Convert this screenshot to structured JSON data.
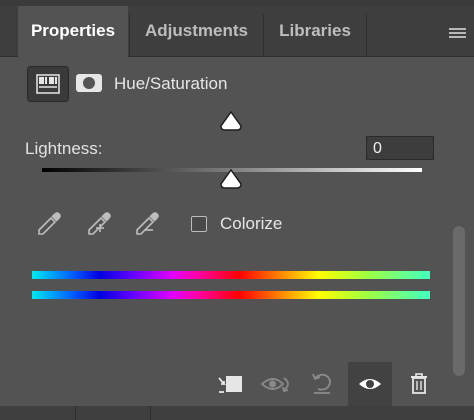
{
  "tabs": [
    {
      "label": "Properties",
      "active": true
    },
    {
      "label": "Adjustments",
      "active": false
    },
    {
      "label": "Libraries",
      "active": false
    }
  ],
  "panel": {
    "layer_title": "Hue/Saturation",
    "lightness_label": "Lightness:",
    "lightness_value": "0",
    "colorize_label": "Colorize",
    "colorize_checked": false
  },
  "icons": [
    "adjustment-layer-icon",
    "layer-mask-icon",
    "eyedropper-icon",
    "eyedropper-add-icon",
    "eyedropper-subtract-icon",
    "clip-to-layer-icon",
    "view-previous-state-icon",
    "reset-icon",
    "visibility-eye-icon",
    "trash-icon",
    "panel-menu-icon"
  ]
}
